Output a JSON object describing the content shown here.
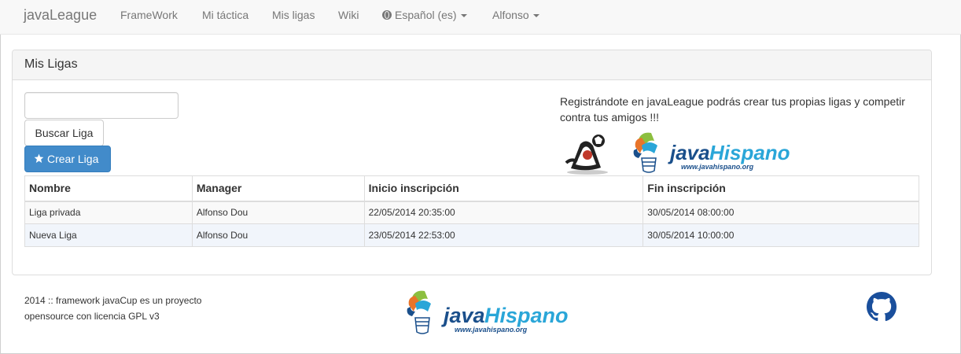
{
  "navbar": {
    "brand": "javaLeague",
    "items": [
      "FrameWork",
      "Mi táctica",
      "Mis ligas",
      "Wiki"
    ],
    "language": "Español (es)",
    "user": "Alfonso"
  },
  "panel": {
    "title": "Mis Ligas",
    "search_value": "",
    "search_button": "Buscar Liga",
    "create_button": "Crear Liga",
    "promo_text": "Registrándote en javaLeague podrás crear tus propias ligas y competir contra tus amigos !!!"
  },
  "table": {
    "headers": [
      "Nombre",
      "Manager",
      "Inicio inscripción",
      "Fin inscripción"
    ],
    "rows": [
      [
        "Liga privada",
        "Alfonso Dou",
        "22/05/2014 20:35:00",
        "30/05/2014 08:00:00"
      ],
      [
        "Nueva Liga",
        "Alfonso Dou",
        "23/05/2014 22:53:00",
        "30/05/2014 10:00:00"
      ]
    ]
  },
  "logo": {
    "name_java": "java",
    "name_hispano": "Hispano",
    "url": "www.javahispano.org"
  },
  "footer": {
    "line1": "2014 :: framework javaCup es un proyecto",
    "line2": "opensource con licencia GPL v3"
  },
  "colors": {
    "primary": "#428bca",
    "logo_blue": "#1a4f8b",
    "logo_cyan": "#2aa6d8",
    "logo_orange": "#e8742a",
    "logo_green": "#8cbf3f"
  },
  "icons": [
    "globe-icon",
    "caret-down-icon",
    "star-icon",
    "github-icon",
    "duke-mascot-icon"
  ]
}
